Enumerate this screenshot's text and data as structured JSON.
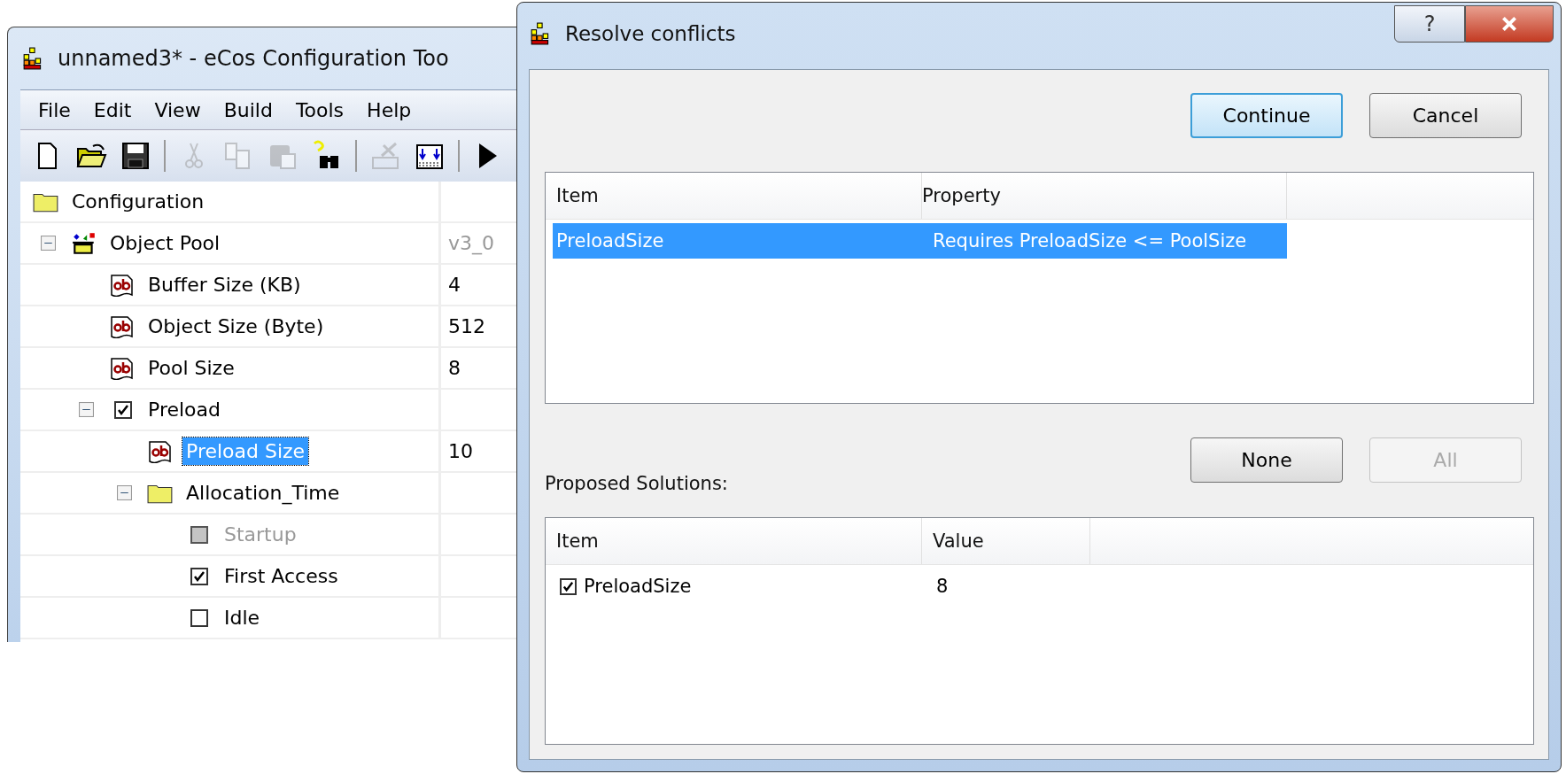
{
  "main_window": {
    "title": "unnamed3* - eCos Configuration Too",
    "menu": [
      {
        "label": "File"
      },
      {
        "label": "Edit"
      },
      {
        "label": "View"
      },
      {
        "label": "Build"
      },
      {
        "label": "Tools"
      },
      {
        "label": "Help"
      }
    ],
    "toolbar": [
      {
        "kind": "new",
        "disabled": false
      },
      {
        "kind": "open",
        "disabled": false
      },
      {
        "kind": "save",
        "disabled": false
      },
      {
        "kind": "separator"
      },
      {
        "kind": "cut",
        "disabled": true
      },
      {
        "kind": "copy",
        "disabled": true
      },
      {
        "kind": "paste",
        "disabled": true
      },
      {
        "kind": "find",
        "disabled": false
      },
      {
        "kind": "separator"
      },
      {
        "kind": "build",
        "disabled": true
      },
      {
        "kind": "generate",
        "disabled": false
      },
      {
        "kind": "separator"
      },
      {
        "kind": "run",
        "disabled": false
      }
    ],
    "tree": [
      {
        "kind": "folder",
        "label": "Configuration",
        "selected": false,
        "children": [
          {
            "kind": "package",
            "label": "Object Pool",
            "value": "v3_0",
            "expanded": true,
            "selected": false,
            "children": [
              {
                "kind": "text",
                "label": "Buffer Size (KB)",
                "value": "4",
                "selected": false
              },
              {
                "kind": "text",
                "label": "Object Size (Byte)",
                "value": "512",
                "selected": false
              },
              {
                "kind": "text",
                "label": "Pool Size",
                "value": "8",
                "selected": false
              },
              {
                "kind": "checkbox",
                "label": "Preload",
                "checked": true,
                "disabled": false,
                "expanded": true,
                "selected": false,
                "children": [
                  {
                    "kind": "text",
                    "label": "Preload Size",
                    "value": "10",
                    "selected": true
                  },
                  {
                    "kind": "folder",
                    "label": "Allocation_Time",
                    "expanded": true,
                    "selected": false,
                    "children": [
                      {
                        "kind": "checkbox",
                        "label": "Startup",
                        "checked": false,
                        "disabled": true,
                        "selected": false
                      },
                      {
                        "kind": "checkbox",
                        "label": "First Access",
                        "checked": true,
                        "disabled": false,
                        "selected": false
                      },
                      {
                        "kind": "checkbox",
                        "label": "Idle",
                        "checked": false,
                        "disabled": false,
                        "selected": false
                      }
                    ]
                  }
                ]
              }
            ]
          }
        ]
      }
    ]
  },
  "dialog": {
    "title": "Resolve conflicts",
    "help_button": "?",
    "top_buttons": [
      {
        "label": "Continue",
        "default": true,
        "disabled": false
      },
      {
        "label": "Cancel",
        "default": false,
        "disabled": false
      }
    ],
    "conflicts": {
      "columns": [
        "Item",
        "Property"
      ],
      "rows": [
        {
          "item": "PreloadSize",
          "property": "Requires PreloadSize <= PoolSize",
          "selected": true
        }
      ]
    },
    "solutions_label": "Proposed Solutions:",
    "solution_buttons": [
      {
        "label": "None",
        "default": false,
        "disabled": false
      },
      {
        "label": "All",
        "default": false,
        "disabled": true
      }
    ],
    "solutions": {
      "columns": [
        "Item",
        "Value"
      ],
      "rows": [
        {
          "item": "PreloadSize",
          "value": "8",
          "checked": true
        }
      ]
    }
  }
}
